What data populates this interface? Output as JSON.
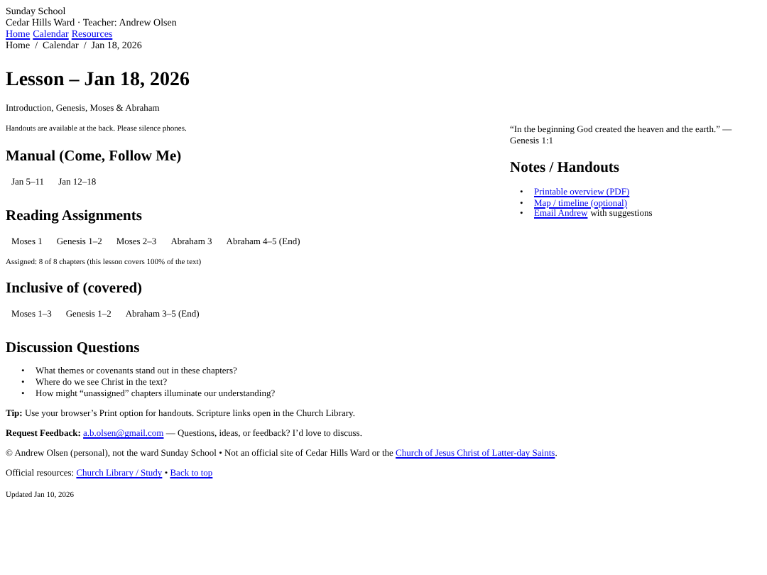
{
  "header": {
    "title": "Sunday School",
    "subtitle": "Cedar Hills Ward · Teacher: Andrew Olsen",
    "nav": [
      "Home",
      "Calendar",
      "Resources"
    ],
    "breadcrumb": "Home  /  Calendar  /  Jan 18, 2026"
  },
  "lesson": {
    "title": "Lesson – Jan 18, 2026",
    "topics": "Introduction, Genesis, Moses & Abraham",
    "notice": "Handouts are available at the back. Please silence phones."
  },
  "manual": {
    "heading": "Manual (Come, Follow Me)",
    "chips": [
      "Jan 5–11",
      "Jan 12–18"
    ]
  },
  "reading": {
    "heading": "Reading Assignments",
    "chips": [
      "Moses 1",
      "Genesis 1–2",
      "Moses 2–3",
      "Abraham 3",
      "Abraham 4–5 (End)"
    ],
    "summary": "Assigned: 8 of 8 chapters (this lesson covers 100% of the text)"
  },
  "inclusive": {
    "heading": "Inclusive of (covered)",
    "chips": [
      "Moses 1–3",
      "Genesis 1–2",
      "Abraham 3–5 (End)"
    ]
  },
  "discussion": {
    "heading": "Discussion Questions",
    "marker": "•",
    "questions": [
      "What themes or covenants stand out in these chapters?",
      "Where do we see Christ in the text?",
      "How might “unassigned” chapters illuminate our understanding?"
    ]
  },
  "aside": {
    "quote": "“In the beginning God created the heaven and the earth.” — Genesis 1:1",
    "heading": "Notes / Handouts",
    "marker": "•",
    "items": [
      {
        "link": "Printable overview (PDF)"
      },
      {
        "link": "Map / timeline (optional)"
      },
      {
        "link": "Email Andrew",
        "suffix": "with suggestions"
      }
    ]
  },
  "footer": {
    "tip": "**Tip:** Use your browser’s Print option for handouts. Scripture links open in the Church Library.",
    "feedback": {
      "label": "Request Feedback:",
      "email": "a.b.olsen@gmail.com",
      "text": "— Questions, ideas, or feedback? I’d love to discuss."
    },
    "copyright": {
      "text": "© Andrew Olsen (personal), not the ward Sunday School • Not an official site of Cedar Hills Ward or the",
      "link": "Church of Jesus Christ of Latter-day Saints",
      "end": "."
    },
    "resources": {
      "label": "Official resources:",
      "links": [
        "Church Library / Study",
        "Back to top"
      ],
      "separator": "•"
    },
    "updated": "Updated Jan 10, 2026"
  }
}
